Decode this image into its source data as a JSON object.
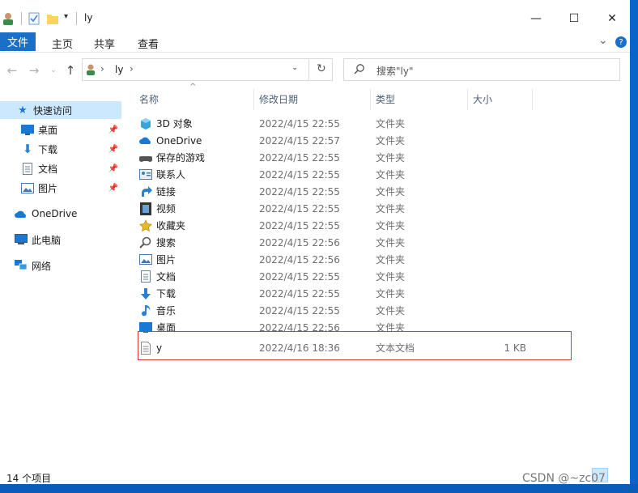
{
  "titlebar": {
    "title": "ly",
    "minimize": "—",
    "maximize": "☐",
    "close": "✕"
  },
  "ribbon": {
    "file_tab": "文件",
    "tabs": [
      "主页",
      "共享",
      "查看"
    ],
    "expand": "⌄",
    "help": "?"
  },
  "address": {
    "path": [
      "ly"
    ],
    "sep": "›",
    "search_placeholder": "搜索\"ly\""
  },
  "sidebar": {
    "quick_access": "快速访问",
    "pinned": [
      {
        "label": "桌面",
        "icon": "desktop-icon"
      },
      {
        "label": "下载",
        "icon": "download-icon"
      },
      {
        "label": "文档",
        "icon": "document-icon"
      },
      {
        "label": "图片",
        "icon": "pictures-icon"
      }
    ],
    "onedrive": "OneDrive",
    "this_pc": "此电脑",
    "network": "网络"
  },
  "columns": {
    "name": "名称",
    "date": "修改日期",
    "type": "类型",
    "size": "大小"
  },
  "files": [
    {
      "name": "3D 对象",
      "date": "2022/4/15 22:55",
      "type": "文件夹",
      "size": "",
      "icon": "3d-objects-icon",
      "color": "#3aa3d9"
    },
    {
      "name": "OneDrive",
      "date": "2022/4/15 22:57",
      "type": "文件夹",
      "size": "",
      "icon": "onedrive-icon",
      "color": "#1a78d4"
    },
    {
      "name": "保存的游戏",
      "date": "2022/4/15 22:55",
      "type": "文件夹",
      "size": "",
      "icon": "saved-games-icon",
      "color": "#555555"
    },
    {
      "name": "联系人",
      "date": "2022/4/15 22:55",
      "type": "文件夹",
      "size": "",
      "icon": "contacts-icon",
      "color": "#4a78b0"
    },
    {
      "name": "链接",
      "date": "2022/4/15 22:55",
      "type": "文件夹",
      "size": "",
      "icon": "links-icon",
      "color": "#2b7fd4"
    },
    {
      "name": "视频",
      "date": "2022/4/15 22:55",
      "type": "文件夹",
      "size": "",
      "icon": "videos-icon",
      "color": "#333333"
    },
    {
      "name": "收藏夹",
      "date": "2022/4/15 22:55",
      "type": "文件夹",
      "size": "",
      "icon": "favorites-icon",
      "color": "#e8b828"
    },
    {
      "name": "搜索",
      "date": "2022/4/15 22:56",
      "type": "文件夹",
      "size": "",
      "icon": "search-folder-icon",
      "color": "#555555"
    },
    {
      "name": "图片",
      "date": "2022/4/15 22:56",
      "type": "文件夹",
      "size": "",
      "icon": "pictures-icon",
      "color": "#4a78b0"
    },
    {
      "name": "文档",
      "date": "2022/4/15 22:55",
      "type": "文件夹",
      "size": "",
      "icon": "document-icon",
      "color": "#6a7f9a"
    },
    {
      "name": "下载",
      "date": "2022/4/15 22:55",
      "type": "文件夹",
      "size": "",
      "icon": "download-icon",
      "color": "#2b7fd4"
    },
    {
      "name": "音乐",
      "date": "2022/4/15 22:55",
      "type": "文件夹",
      "size": "",
      "icon": "music-icon",
      "color": "#2b7fd4"
    },
    {
      "name": "桌面",
      "date": "2022/4/15 22:56",
      "type": "文件夹",
      "size": "",
      "icon": "desktop-icon",
      "color": "#1a78d4"
    },
    {
      "name": "y",
      "date": "2022/4/16 18:36",
      "type": "文本文档",
      "size": "1 KB",
      "icon": "text-file-icon",
      "color": "#888888"
    }
  ],
  "status": {
    "count": "14 个项目"
  },
  "watermark": "CSDN @~zc07"
}
